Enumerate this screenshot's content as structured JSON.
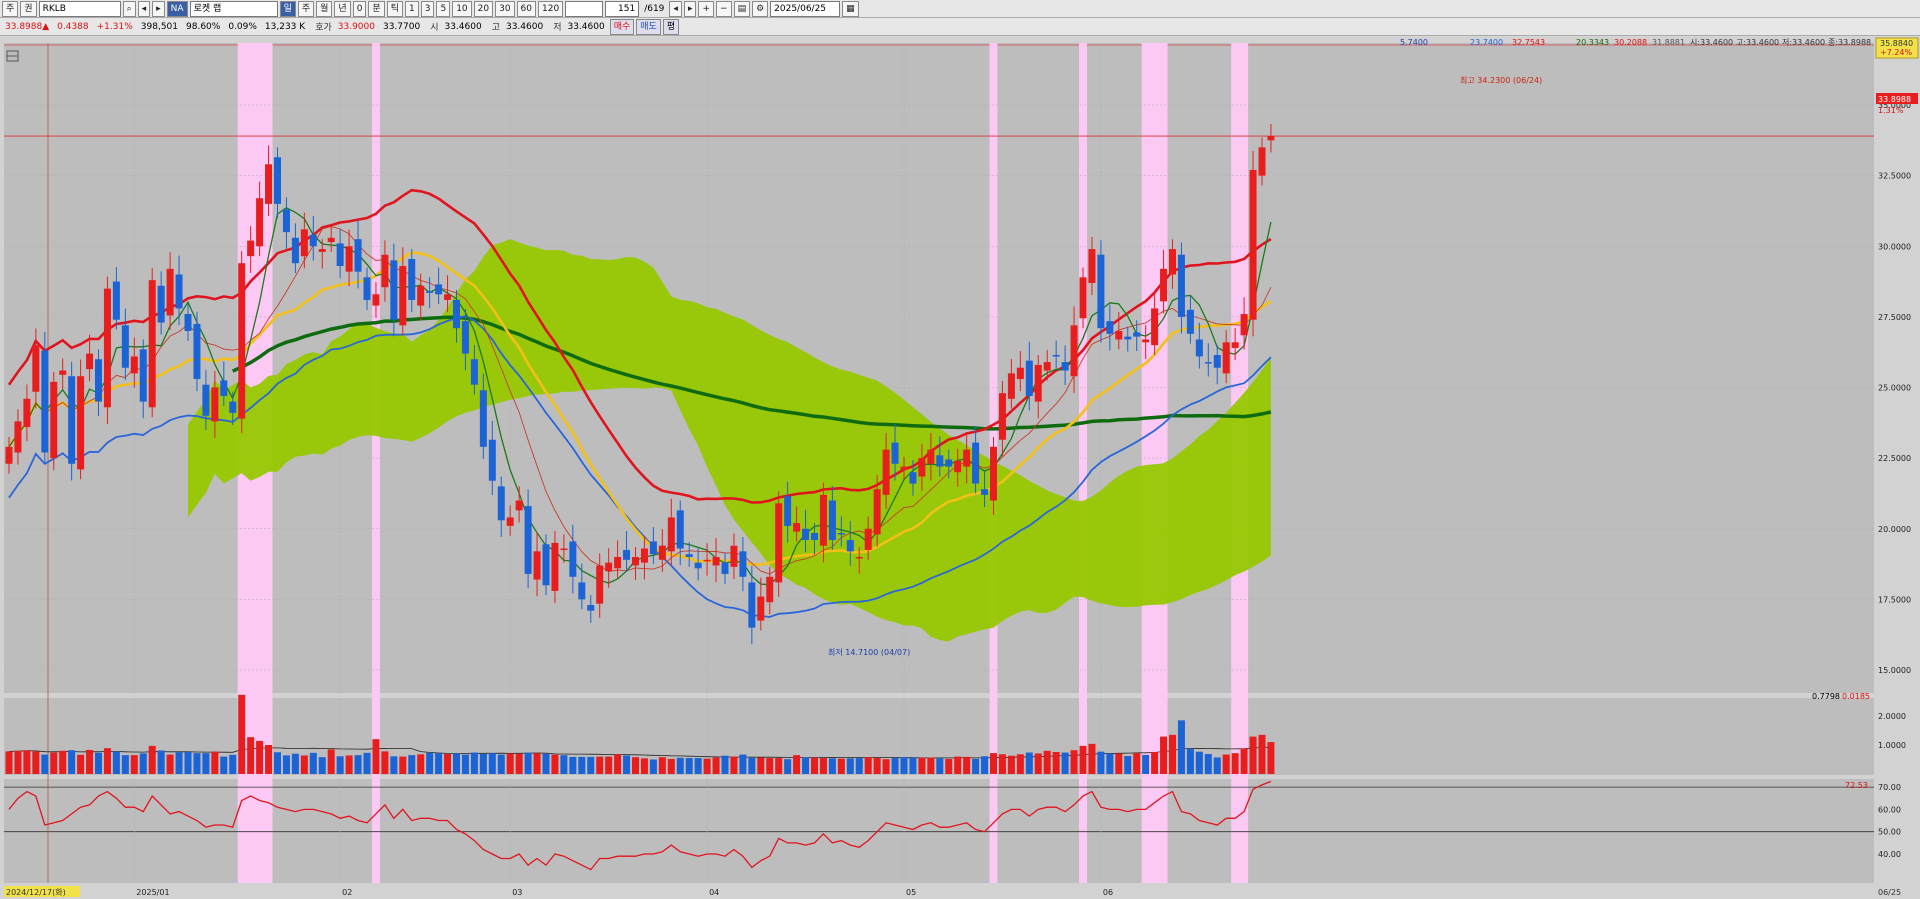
{
  "toolbar": {
    "market_a": "주",
    "market_b": "권",
    "symbol": "RKLB",
    "name_badge": "NA",
    "company": "로켓 랩",
    "period_buttons": [
      "일",
      "주",
      "월",
      "년",
      "0",
      "분",
      "틱"
    ],
    "interval_buttons": [
      "1",
      "3",
      "5",
      "10",
      "20",
      "30",
      "60",
      "120"
    ],
    "counter": "151",
    "counter_total": "/619",
    "date": "2025/06/25"
  },
  "quote": {
    "price": "33.8988▲",
    "change": "0.4388",
    "change_pct": "+1.31%",
    "volume": "398,501",
    "volume_ratio": "98.60%",
    "turnover": "0.09%",
    "amount": "13,233 K",
    "hoga_label": "호가",
    "ask": "33.9000",
    "bid": "33.7700",
    "open_label": "시",
    "open": "33.4600",
    "high_label": "고",
    "high": "33.4600",
    "low_label": "저",
    "low": "33.4600",
    "buy_button": "매수",
    "sell_button": "매도",
    "flat_button": "평"
  },
  "legend_values": [
    "5.7400",
    "23.7400",
    "32.7543",
    "20.3343",
    "30.2088",
    "31.8881",
    "시:33.4600",
    "고:33.4600",
    "저:33.4600",
    "종:33.8988"
  ],
  "price_panel": {
    "current_label": "33.8988",
    "current_pct": "1.31%",
    "top_value": "35.8840",
    "top_pct": "+7.24%",
    "high_annotation": "최고 34.2300 (06/24)",
    "low_annotation": "최저 14.7100 (04/07)"
  },
  "volume_panel": {
    "label_a": "0.7798",
    "label_b": "0.0185"
  },
  "rsi_panel": {
    "label": "72.53"
  },
  "x_axis": {
    "cursor_date": "2024/12/17(화)",
    "end_label": "06/25"
  },
  "colors": {
    "up": "#e81e1e",
    "down": "#1c63d6",
    "cloud": "#97c800",
    "highlight": "#fcc8f4",
    "background": "#bdbdbd"
  },
  "chart_data": {
    "type": "candlestick",
    "y_price_ticks": [
      15,
      17.5,
      20,
      22.5,
      25,
      27.5,
      30,
      32.5,
      35
    ],
    "y_price_tick_labels": [
      "15.0000",
      "17.5000",
      "20.0000",
      "22.5000",
      "25.0000",
      "27.5000",
      "30.0000",
      "32.5000",
      "35.0000"
    ],
    "y_volume_ticks": [
      1,
      2
    ],
    "y_volume_tick_labels": [
      "1.0000",
      "2.0000"
    ],
    "y_rsi_ticks": [
      40,
      50,
      60,
      70
    ],
    "y_rsi_tick_labels": [
      "40.00",
      "50.00",
      "60.00",
      "70.00"
    ],
    "x_tick_labels": [
      {
        "index": 14,
        "label": "2025/01"
      },
      {
        "index": 37,
        "label": "02"
      },
      {
        "index": 56,
        "label": "03"
      },
      {
        "index": 78,
        "label": "04"
      },
      {
        "index": 100,
        "label": "05"
      },
      {
        "index": 122,
        "label": "06"
      }
    ],
    "highlight_bands": [
      [
        26,
        29
      ],
      [
        41,
        41
      ],
      [
        110,
        110
      ],
      [
        120,
        120
      ],
      [
        127,
        129
      ],
      [
        137,
        138
      ]
    ],
    "close": [
      22.9,
      23.8,
      24.6,
      26.5,
      22.7,
      25.2,
      25.6,
      22.3,
      25.4,
      26.2,
      24.5,
      28.5,
      27.4,
      25.7,
      26.1,
      24.5,
      28.8,
      27.3,
      29.2,
      27.8,
      27.0,
      25.3,
      24.0,
      25.0,
      24.7,
      24.1,
      29.4,
      30.2,
      31.7,
      32.9,
      31.5,
      30.5,
      29.4,
      30.6,
      30.0,
      29.9,
      30.3,
      29.3,
      30.0,
      29.1,
      28.1,
      28.3,
      29.7,
      27.4,
      29.3,
      28.1,
      28.6,
      28.4,
      28.3,
      28.3,
      27.1,
      26.2,
      25.1,
      22.9,
      21.7,
      20.3,
      20.4,
      21.0,
      18.4,
      19.2,
      18.0,
      19.5,
      19.3,
      18.3,
      17.5,
      17.1,
      18.7,
      18.8,
      19.0,
      18.9,
      19.0,
      19.3,
      19.1,
      19.4,
      20.4,
      19.3,
      19.0,
      18.6,
      18.9,
      19.0,
      18.4,
      19.4,
      18.3,
      16.5,
      17.6,
      18.3,
      20.9,
      20.1,
      20.2,
      19.6,
      19.6,
      21.2,
      19.6,
      19.8,
      19.2,
      19.0,
      20.0,
      21.4,
      22.8,
      22.3,
      22.2,
      21.6,
      22.5,
      22.8,
      22.2,
      22.2,
      22.4,
      22.8,
      21.6,
      21.2,
      22.9,
      24.8,
      25.5,
      25.7,
      24.7,
      25.8,
      25.9,
      26.1,
      25.6,
      27.2,
      28.9,
      29.9,
      27.1,
      26.9,
      27.0,
      26.7,
      26.8,
      26.7,
      27.8,
      29.2,
      29.9,
      27.5,
      26.9,
      26.1,
      25.9,
      25.7,
      26.6,
      26.6,
      27.6,
      32.7,
      33.5,
      33.9
    ],
    "volume": [
      0.78,
      0.8,
      0.82,
      0.78,
      0.67,
      0.74,
      0.8,
      0.82,
      0.66,
      0.83,
      0.73,
      0.89,
      0.77,
      0.65,
      0.65,
      0.71,
      0.97,
      0.81,
      0.67,
      0.75,
      0.76,
      0.72,
      0.72,
      0.77,
      0.6,
      0.66,
      2.73,
      1.27,
      1.14,
      1.0,
      0.75,
      0.64,
      0.7,
      0.64,
      0.73,
      0.58,
      0.85,
      0.61,
      0.64,
      0.65,
      0.73,
      1.2,
      0.78,
      0.61,
      0.6,
      0.65,
      0.68,
      0.73,
      0.72,
      0.69,
      0.71,
      0.67,
      0.74,
      0.69,
      0.72,
      0.67,
      0.71,
      0.7,
      0.73,
      0.72,
      0.7,
      0.67,
      0.65,
      0.59,
      0.59,
      0.59,
      0.6,
      0.6,
      0.68,
      0.64,
      0.58,
      0.54,
      0.5,
      0.58,
      0.52,
      0.56,
      0.55,
      0.55,
      0.53,
      0.57,
      0.63,
      0.6,
      0.67,
      0.56,
      0.57,
      0.55,
      0.55,
      0.51,
      0.65,
      0.57,
      0.56,
      0.55,
      0.54,
      0.53,
      0.54,
      0.55,
      0.58,
      0.55,
      0.51,
      0.55,
      0.58,
      0.56,
      0.56,
      0.57,
      0.54,
      0.52,
      0.6,
      0.59,
      0.52,
      0.61,
      0.72,
      0.68,
      0.63,
      0.68,
      0.74,
      0.71,
      0.8,
      0.76,
      0.74,
      0.82,
      0.97,
      1.04,
      0.77,
      0.7,
      0.71,
      0.62,
      0.72,
      0.66,
      0.76,
      1.29,
      1.35,
      1.85,
      0.87,
      0.77,
      0.69,
      0.57,
      0.67,
      0.72,
      0.88,
      1.29,
      1.35,
      1.1
    ],
    "rsi": [
      60,
      65,
      68,
      66,
      53,
      54,
      55,
      58,
      61,
      62,
      66,
      68,
      65,
      61,
      61,
      59,
      66,
      62,
      58,
      59,
      57,
      55,
      52,
      53,
      53,
      52,
      64,
      66,
      64,
      63,
      61,
      60,
      59,
      60,
      60,
      59,
      58,
      56,
      57,
      55,
      54,
      58,
      62,
      56,
      60,
      55,
      56,
      56,
      55,
      55,
      51,
      49,
      46,
      42,
      40,
      38,
      38,
      40,
      35,
      38,
      35,
      40,
      39,
      37,
      35,
      33,
      38,
      38,
      39,
      39,
      39,
      40,
      40,
      41,
      44,
      41,
      40,
      39,
      40,
      40,
      39,
      42,
      39,
      34,
      37,
      39,
      47,
      45,
      45,
      44,
      45,
      49,
      45,
      46,
      44,
      43,
      46,
      50,
      54,
      53,
      52,
      51,
      53,
      54,
      52,
      52,
      53,
      54,
      51,
      50,
      54,
      58,
      60,
      60,
      57,
      60,
      61,
      61,
      59,
      62,
      66,
      68,
      61,
      60,
      60,
      59,
      60,
      60,
      63,
      66,
      68,
      59,
      58,
      55,
      54,
      53,
      56,
      56,
      59,
      69,
      71,
      72.5
    ]
  }
}
